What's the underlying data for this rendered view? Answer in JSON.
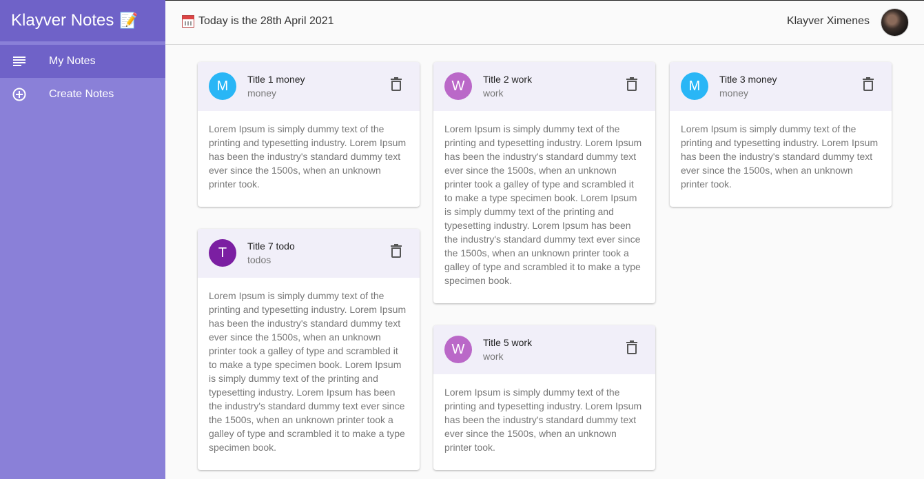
{
  "app": {
    "title": "Klayver Notes",
    "title_emoji": "📝"
  },
  "sidebar": {
    "items": [
      {
        "label": "My Notes",
        "icon": "subject-lines-icon",
        "active": true
      },
      {
        "label": "Create Notes",
        "icon": "add-circle-outline-icon",
        "active": false
      }
    ]
  },
  "header": {
    "date_text": "Today is the 28th April 2021",
    "user_name": "Klayver Ximenes"
  },
  "colors": {
    "sidebar": "#8a80d8",
    "sidebar_active": "#6f62c8",
    "card_header": "#f1eff9",
    "money": "#29b6f6",
    "work": "#ba68c8",
    "todos": "#7b1fa2"
  },
  "notes": [
    {
      "initial": "M",
      "title": "Title 1 money",
      "category": "money",
      "body": "Lorem Ipsum is simply dummy text of the printing and typesetting industry. Lorem Ipsum has been the industry's standard dummy text ever since the 1500s, when an unknown printer took."
    },
    {
      "initial": "W",
      "title": "Title 2 work",
      "category": "work",
      "body": "Lorem Ipsum is simply dummy text of the printing and typesetting industry. Lorem Ipsum has been the industry's standard dummy text ever since the 1500s, when an unknown printer took a galley of type and scrambled it to make a type specimen book. Lorem Ipsum is simply dummy text of the printing and typesetting industry. Lorem Ipsum has been the industry's standard dummy text ever since the 1500s, when an unknown printer took a galley of type and scrambled it to make a type specimen book."
    },
    {
      "initial": "M",
      "title": "Title 3 money",
      "category": "money",
      "body": "Lorem Ipsum is simply dummy text of the printing and typesetting industry. Lorem Ipsum has been the industry's standard dummy text ever since the 1500s, when an unknown printer took."
    },
    {
      "initial": "T",
      "title": "Title 7 todo",
      "category": "todos",
      "body": "Lorem Ipsum is simply dummy text of the printing and typesetting industry. Lorem Ipsum has been the industry's standard dummy text ever since the 1500s, when an unknown printer took a galley of type and scrambled it to make a type specimen book. Lorem Ipsum is simply dummy text of the printing and typesetting industry. Lorem Ipsum has been the industry's standard dummy text ever since the 1500s, when an unknown printer took a galley of type and scrambled it to make a type specimen book."
    },
    {
      "initial": "W",
      "title": "Title 5 work",
      "category": "work",
      "body": "Lorem Ipsum is simply dummy text of the printing and typesetting industry. Lorem Ipsum has been the industry's standard dummy text ever since the 1500s, when an unknown printer took."
    }
  ]
}
